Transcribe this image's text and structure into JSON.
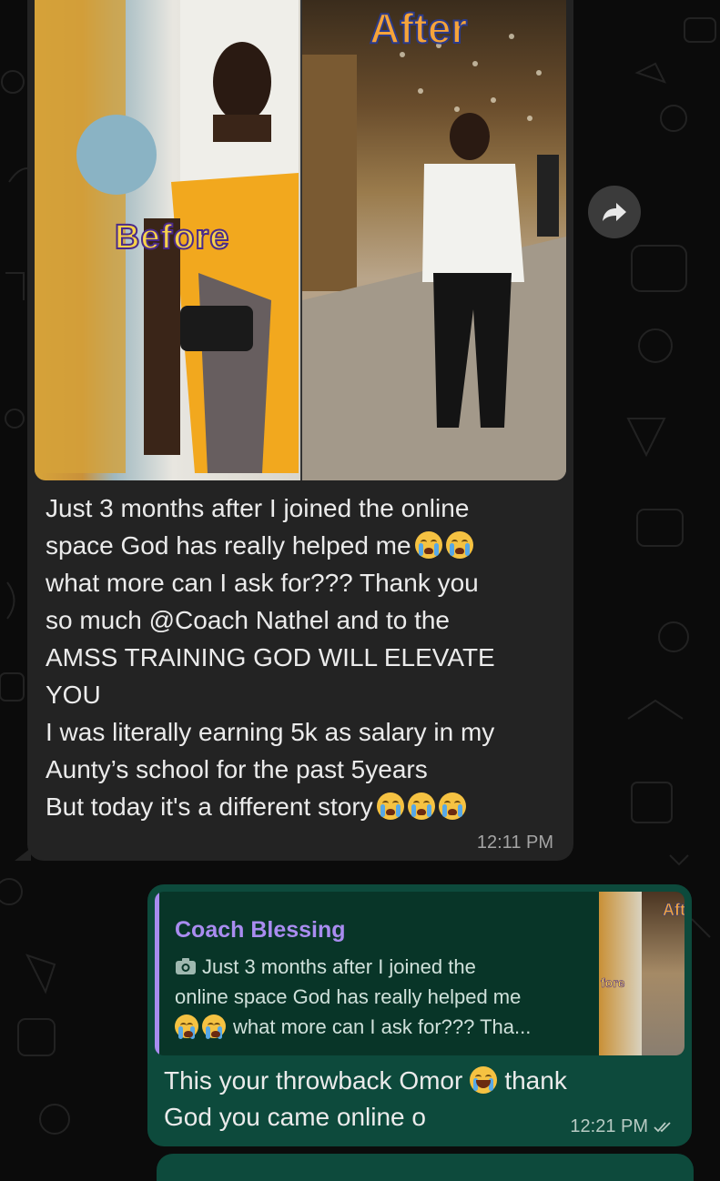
{
  "chat": {
    "incoming": {
      "image_labels": {
        "before": "Before",
        "after": "After"
      },
      "lines": [
        "Just 3 months after I joined the online",
        "space God has really helped me",
        "what more can I ask for??? Thank you",
        "so much @Coach Nathel and to the",
        "AMSS TRAINING GOD WILL ELEVATE",
        "YOU",
        "I was literally earning 5k as salary in my",
        "Aunty’s school for the past 5years",
        "But today it's a different story"
      ],
      "time": "12:11 PM"
    },
    "outgoing": {
      "quoted": {
        "author": "Coach Blessing",
        "lines": [
          "Just 3 months after I joined the",
          "online space God has really helped me",
          "what more can I ask for??? Tha..."
        ],
        "thumb_labels": {
          "before": "fore",
          "after": "Aft"
        }
      },
      "lines": [
        "This your throwback Omor",
        "thank",
        "God you came online o"
      ],
      "time": "12:21 PM"
    }
  },
  "icons": {
    "forward": "forward-arrow-icon",
    "camera": "camera-icon",
    "read_receipt": "double-check-icon",
    "emoji_cry": "loudly-crying-face-icon",
    "emoji_laugh": "tears-of-joy-icon"
  },
  "colors": {
    "incoming_bubble": "#232323",
    "outgoing_bubble": "#0d4a3c",
    "quote_accent": "#a98cf0",
    "background": "#0b0b0b"
  }
}
